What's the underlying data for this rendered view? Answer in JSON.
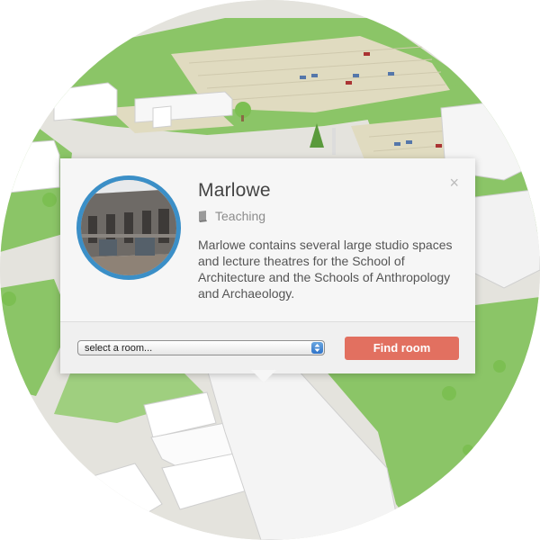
{
  "popup": {
    "title": "Marlowe",
    "category": "Teaching",
    "description": "Marlowe contains several large studio spaces and lecture theatres for the School of Architecture and the Schools of Anthropology and Archaeology.",
    "close_label": "×",
    "photo_alt": "Photo of Marlowe building"
  },
  "room_select": {
    "value": "select a room..."
  },
  "find_button": {
    "label": "Find room"
  },
  "colors": {
    "accent_ring": "#3b8fc7",
    "button": "#e27060",
    "grass": "#8bc567",
    "road": "#e4e3dd",
    "parking": "#e0dbc0"
  },
  "icons": {
    "category": "book-icon",
    "close": "close-icon",
    "select": "select-arrows-icon"
  }
}
